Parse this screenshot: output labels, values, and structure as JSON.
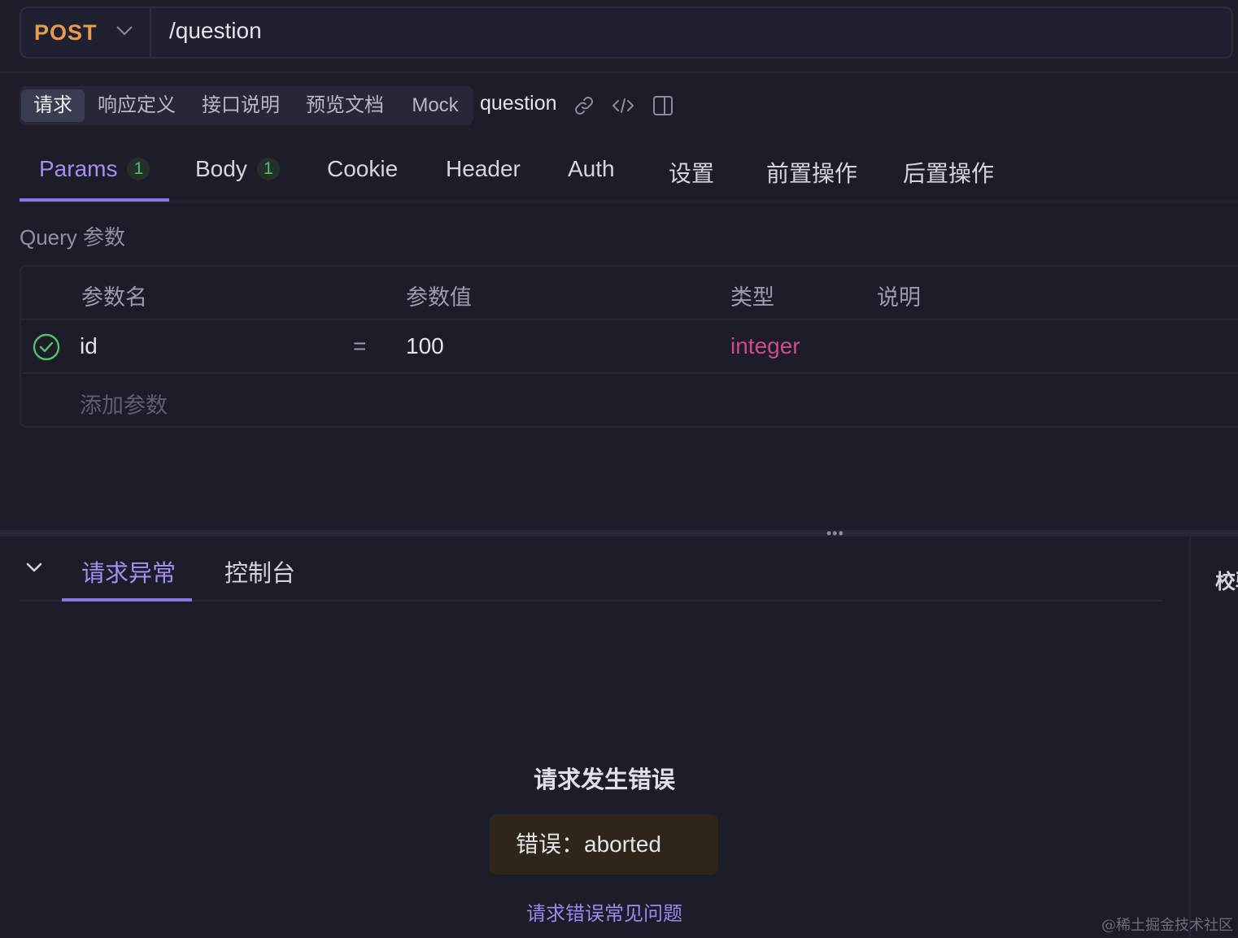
{
  "request": {
    "method": "POST",
    "url": "/question"
  },
  "segment_tabs": [
    {
      "label": "请求",
      "active": true
    },
    {
      "label": "响应定义",
      "active": false
    },
    {
      "label": "接口说明",
      "active": false
    },
    {
      "label": "预览文档",
      "active": false
    },
    {
      "label": "Mock",
      "active": false
    }
  ],
  "api_name": "question",
  "toolbar_icons": [
    "link-icon",
    "code-icon",
    "panel-toggle-icon"
  ],
  "request_tabs": [
    {
      "label": "Params",
      "count": "1",
      "active": true
    },
    {
      "label": "Body",
      "count": "1",
      "active": false
    },
    {
      "label": "Cookie",
      "active": false
    },
    {
      "label": "Header",
      "active": false
    },
    {
      "label": "Auth",
      "active": false
    },
    {
      "label": "设置",
      "active": false
    },
    {
      "label": "前置操作",
      "active": false
    },
    {
      "label": "后置操作",
      "active": false
    }
  ],
  "query_section": {
    "title": "Query 参数",
    "columns": [
      "参数名",
      "参数值",
      "类型",
      "说明"
    ],
    "rows": [
      {
        "enabled": true,
        "name": "id",
        "operator": "=",
        "value": "100",
        "type": "integer",
        "description": ""
      }
    ],
    "add_placeholder": "添加参数"
  },
  "bottom_panel": {
    "tabs": [
      {
        "label": "请求异常",
        "active": true
      },
      {
        "label": "控制台",
        "active": false
      }
    ],
    "side_label": "校验",
    "error": {
      "title": "请求发生错误",
      "message": "错误：aborted",
      "faq_link": "请求错误常见问题"
    }
  },
  "watermark": "@稀土掘金技术社区",
  "colors": {
    "background": "#1c1d28",
    "method": "#e79b4d",
    "accent": "#8c73e6",
    "type": "#cf4a8a",
    "check": "#55c06a"
  }
}
